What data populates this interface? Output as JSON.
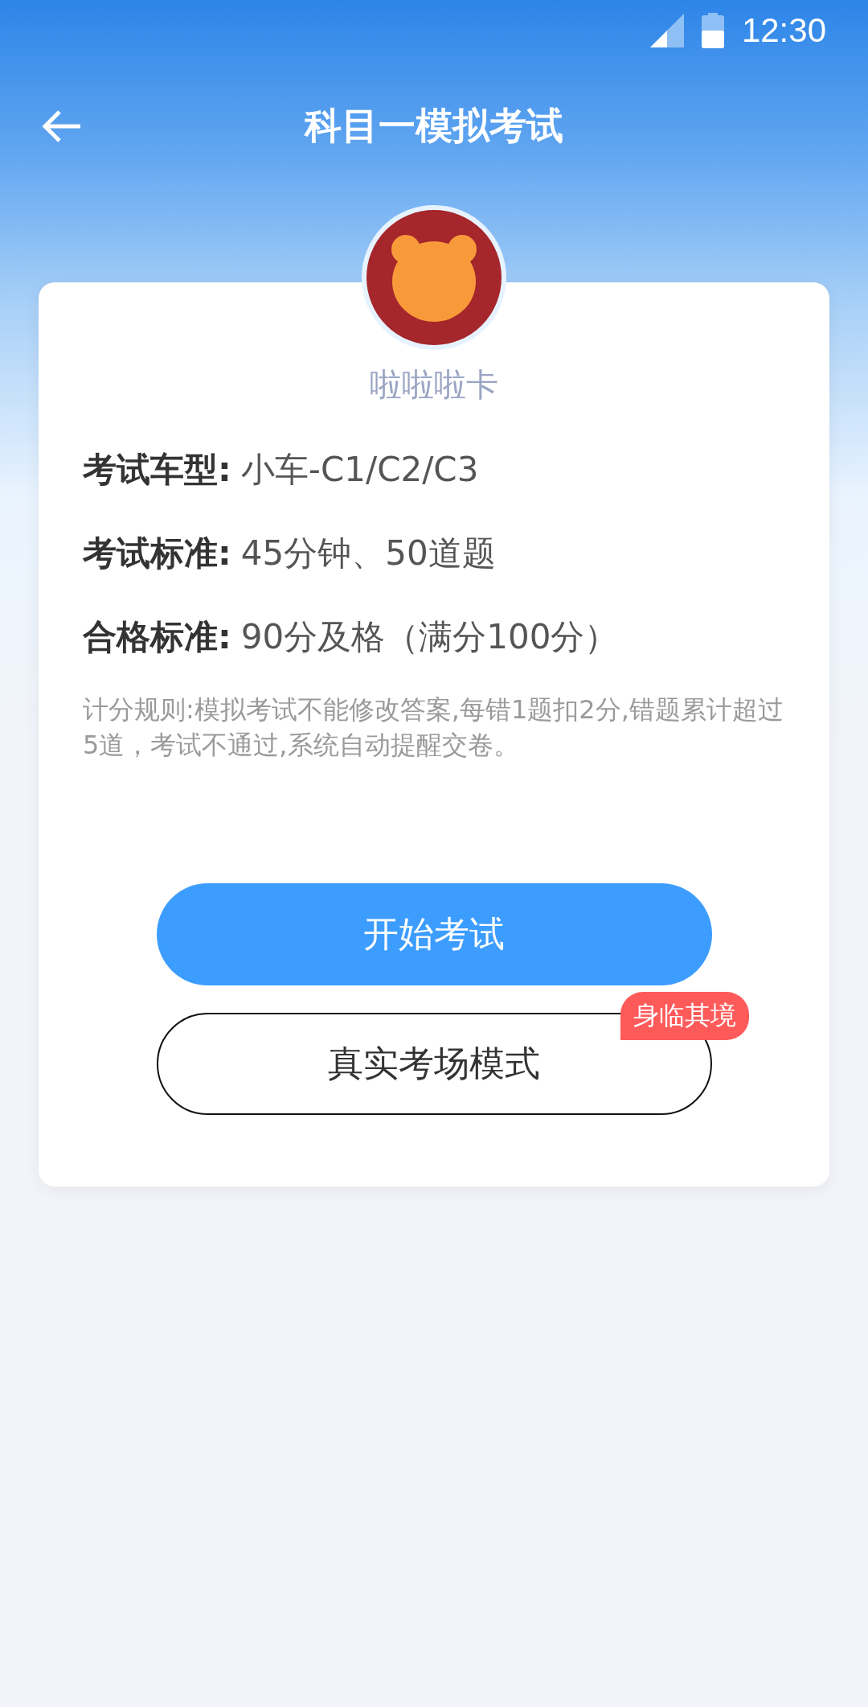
{
  "status_bar": {
    "time": "12:30"
  },
  "header": {
    "title": "科目一模拟考试"
  },
  "profile": {
    "name": "啦啦啦卡"
  },
  "info_rows": [
    {
      "label": "考试车型:",
      "value": "小车-C1/C2/C3"
    },
    {
      "label": "考试标准:",
      "value": "45分钟、50道题"
    },
    {
      "label": "合格标准:",
      "value": "90分及格（满分100分）"
    }
  ],
  "rules": "计分规则:模拟考试不能修改答案,每错1题扣2分,错题累计超过5道，考试不通过,系统自动提醒交卷。",
  "buttons": [
    {
      "label": "开始考试",
      "kind": "primary"
    },
    {
      "label": "真实考场模式",
      "kind": "outline",
      "badge": "身临其境"
    }
  ]
}
